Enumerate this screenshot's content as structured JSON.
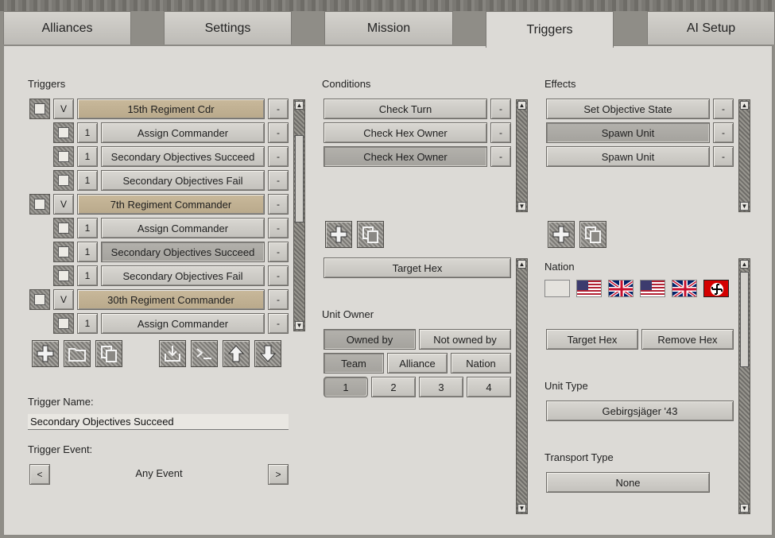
{
  "tabs": [
    {
      "label": "Alliances"
    },
    {
      "label": "Settings"
    },
    {
      "label": "Mission"
    },
    {
      "label": "Triggers"
    },
    {
      "label": "AI Setup"
    }
  ],
  "triggers": {
    "heading": "Triggers",
    "rows": [
      {
        "num": "V",
        "label": "15th Regiment Cdr",
        "kind": "group"
      },
      {
        "num": "1",
        "label": "Assign Commander",
        "kind": "item"
      },
      {
        "num": "1",
        "label": "Secondary Objectives Succeed",
        "kind": "item"
      },
      {
        "num": "1",
        "label": "Secondary Objectives Fail",
        "kind": "item"
      },
      {
        "num": "V",
        "label": "7th Regiment Commander",
        "kind": "group"
      },
      {
        "num": "1",
        "label": "Assign Commander",
        "kind": "item"
      },
      {
        "num": "1",
        "label": "Secondary Objectives Succeed",
        "kind": "item"
      },
      {
        "num": "1",
        "label": "Secondary Objectives Fail",
        "kind": "item"
      },
      {
        "num": "V",
        "label": "30th Regiment Commander",
        "kind": "group"
      },
      {
        "num": "1",
        "label": "Assign Commander",
        "kind": "item"
      }
    ],
    "minus_label": "-",
    "name_label": "Trigger Name:",
    "name_value": "Secondary Objectives Succeed",
    "event_label": "Trigger Event:",
    "event_value": "Any Event",
    "prev_label": "<",
    "next_label": ">"
  },
  "conditions": {
    "heading": "Conditions",
    "items": [
      "Check Turn",
      "Check Hex Owner",
      "Check Hex Owner"
    ],
    "target_hex": "Target Hex",
    "unit_owner_label": "Unit Owner",
    "owned_by": "Owned by",
    "not_owned_by": "Not owned by",
    "team": "Team",
    "alliance": "Alliance",
    "nation": "Nation",
    "numbers": [
      "1",
      "2",
      "3",
      "4"
    ]
  },
  "effects": {
    "heading": "Effects",
    "items": [
      "Set Objective State",
      "Spawn Unit",
      "Spawn Unit"
    ],
    "nation_label": "Nation",
    "flags": [
      "blank-flag",
      "us-flag",
      "uk-flag",
      "us-flag",
      "uk-flag",
      "german-flag"
    ],
    "target_hex": "Target Hex",
    "remove_hex": "Remove Hex",
    "unit_type_label": "Unit Type",
    "unit_type_value": "Gebirgsjäger '43",
    "transport_label": "Transport Type",
    "transport_value": "None"
  },
  "colors": {
    "tan": "#c4b596",
    "panel": "#dcdad6",
    "dark": "#aeaca7"
  }
}
